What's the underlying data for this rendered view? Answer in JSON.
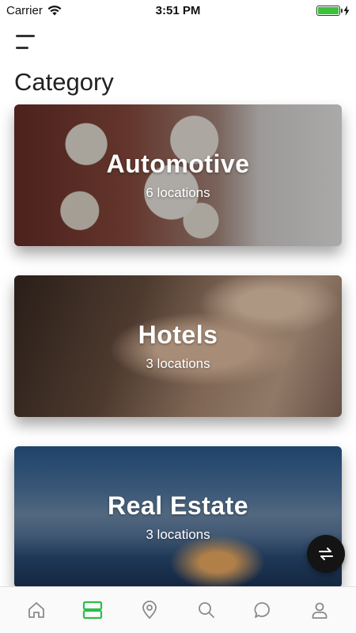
{
  "status_bar": {
    "carrier": "Carrier",
    "time": "3:51 PM",
    "battery_level": 1.0
  },
  "header": {
    "menu_icon": "hamburger-menu-icon",
    "title": "Category"
  },
  "categories": [
    {
      "title": "Automotive",
      "subtitle": "6 locations"
    },
    {
      "title": "Hotels",
      "subtitle": "3 locations"
    },
    {
      "title": "Real Estate",
      "subtitle": "3 locations"
    }
  ],
  "fab": {
    "icon": "swap-arrows-icon"
  },
  "tab_bar": {
    "active_color": "#2bbf4a",
    "inactive_color": "#8a8a8a",
    "active_index": 1,
    "tabs": [
      {
        "icon": "home-icon"
      },
      {
        "icon": "category-list-icon"
      },
      {
        "icon": "map-pin-icon"
      },
      {
        "icon": "search-icon"
      },
      {
        "icon": "chat-bubble-icon"
      },
      {
        "icon": "profile-icon"
      }
    ]
  }
}
